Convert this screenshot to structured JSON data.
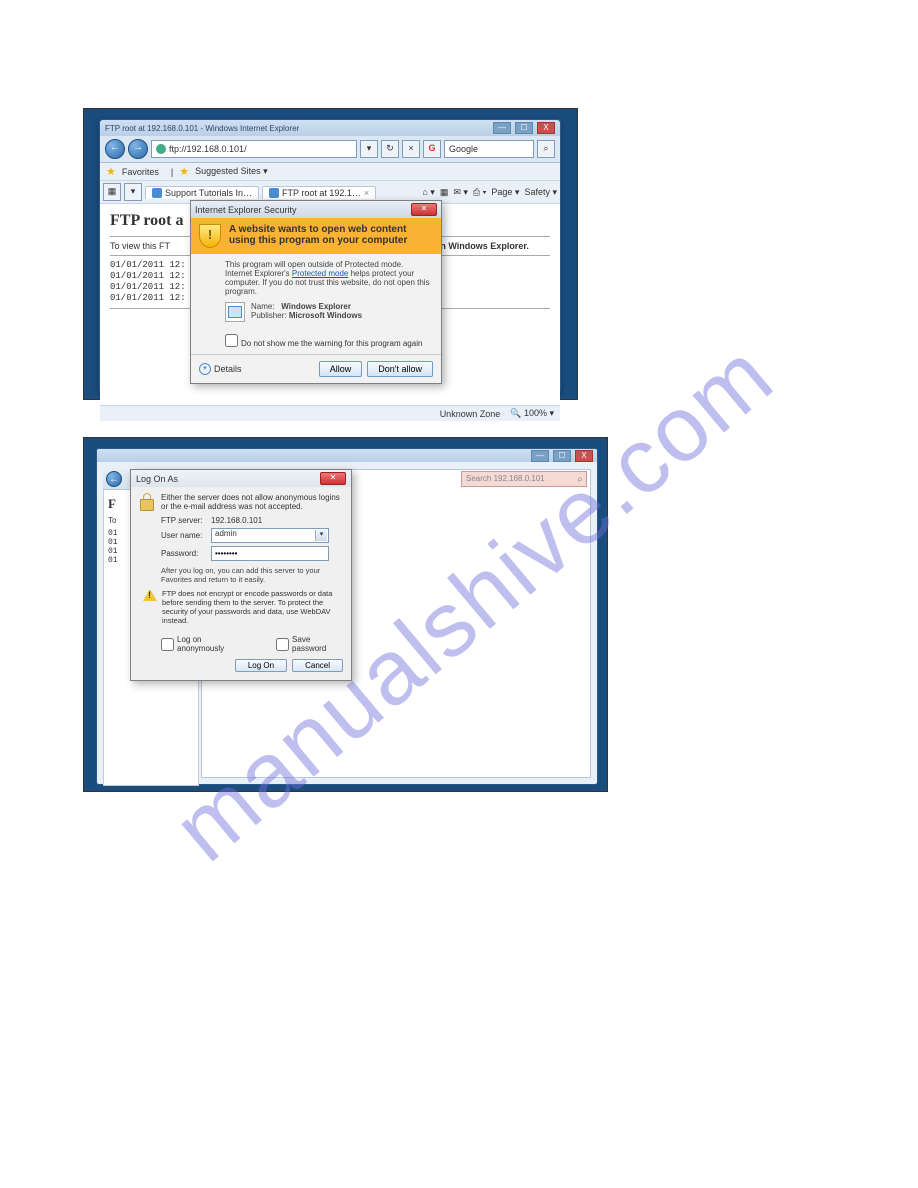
{
  "watermark": "manualshive.com",
  "frame1": {
    "window_title": "FTP root at 192.168.0.101 - Windows Internet Explorer",
    "win_min": "—",
    "win_max": "☐",
    "win_close": "X",
    "address": "ftp://192.168.0.101/",
    "refresh_glyph": "↻",
    "stop_glyph": "×",
    "search_engine_glyph": "G",
    "search_placeholder": "Google",
    "search_go_glyph": "⌕",
    "favorites_label": "Favorites",
    "suggested_sites": "Suggested Sites ▾",
    "tab1": "Support Tutorials In…",
    "tab2": "FTP root at 192.1…",
    "tab2_close": "×",
    "tb_home_glyph": "⌂ ▾",
    "tb_feed_glyph": "▦",
    "tb_mail_glyph": "✉ ▾",
    "tb_print_glyph": "⎙ ▾",
    "tb_page": "Page ▾",
    "tb_safety": "Safety ▾",
    "page_heading": "FTP root a",
    "page_instruct_pre": "To view this FT",
    "page_instruct_post": "ite in Windows Explorer.",
    "file_rows": [
      "01/01/2011 12:",
      "01/01/2011 12:",
      "01/01/2011 12:",
      "01/01/2011 12:"
    ],
    "status_zone": "Unknown Zone",
    "status_zoom": "100% ▾",
    "dialog": {
      "title": "Internet Explorer Security",
      "close_glyph": "✕",
      "headline": "A website wants to open web content using this program on your computer",
      "body_pre": "This program will open outside of Protected mode. Internet Explorer's ",
      "body_link": "Protected mode",
      "body_post": " helps protect your computer. If you do not trust this website, do not open this program.",
      "prog_name_label": "Name:",
      "prog_name_value": "Windows Explorer",
      "prog_pub_label": "Publisher:",
      "prog_pub_value": "Microsoft Windows",
      "dont_show": "Do not show me the warning for this program again",
      "details": "Details",
      "details_arrow": "▾",
      "allow": "Allow",
      "dont_allow": "Don't allow"
    }
  },
  "frame2": {
    "win_min": "—",
    "win_max": "☐",
    "win_close": "X",
    "search_placeholder": "Search 192.168.0.101",
    "search_glyph": "⌕",
    "left_heading": "F",
    "left_sub": "To",
    "left_dates": [
      "01",
      "01",
      "01",
      "01"
    ],
    "dialog": {
      "title": "Log On As",
      "close_glyph": "✕",
      "msg": "Either the server does not allow anonymous logins or the e-mail address was not accepted.",
      "ftp_server_label": "FTP server:",
      "ftp_server_value": "192.168.0.101",
      "username_label": "User name:",
      "username_value": "admin",
      "password_label": "Password:",
      "password_value": "••••••••",
      "note": "After you log on, you can add this server to your Favorites and return to it easily.",
      "warning": "FTP does not encrypt or encode passwords or data before sending them to the server. To protect the security of your passwords and data, use WebDAV instead.",
      "anon": "Log on anonymously",
      "save": "Save password",
      "logon": "Log On",
      "cancel": "Cancel"
    }
  }
}
